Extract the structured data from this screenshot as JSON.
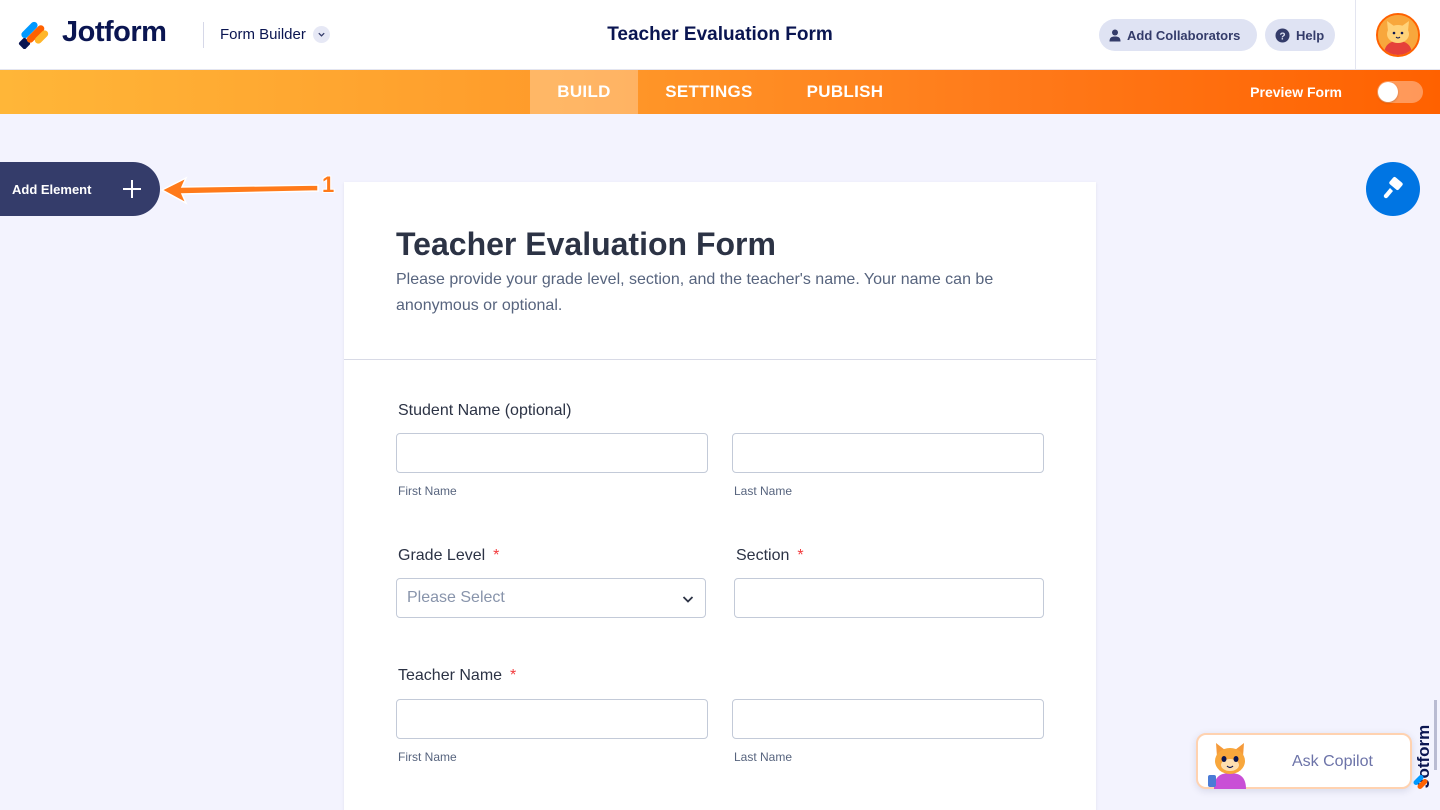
{
  "header": {
    "brand": "Jotform",
    "form_builder_label": "Form Builder",
    "form_title": "Teacher Evaluation Form",
    "add_collaborators_label": "Add Collaborators",
    "help_label": "Help"
  },
  "nav": {
    "tabs": [
      {
        "label": "BUILD",
        "active": true
      },
      {
        "label": "SETTINGS",
        "active": false
      },
      {
        "label": "PUBLISH",
        "active": false
      }
    ],
    "preview_label": "Preview Form",
    "preview_enabled": false
  },
  "sidebar": {
    "add_element_label": "Add Element",
    "step_marker": "1"
  },
  "form": {
    "title": "Teacher Evaluation Form",
    "description": "Please provide your grade level, section, and the teacher's name. Your name can be anonymous or optional.",
    "fields": {
      "student_name": {
        "label": "Student Name (optional)",
        "first_sublabel": "First Name",
        "last_sublabel": "Last Name",
        "first_value": "",
        "last_value": ""
      },
      "grade_level": {
        "label": "Grade Level",
        "required_mark": "*",
        "placeholder": "Please Select"
      },
      "section": {
        "label": "Section",
        "required_mark": "*",
        "value": ""
      },
      "teacher_name": {
        "label": "Teacher Name",
        "required_mark": "*",
        "first_sublabel": "First Name",
        "last_sublabel": "Last Name",
        "first_value": "",
        "last_value": ""
      }
    }
  },
  "copilot": {
    "label": "Ask Copilot"
  },
  "icons": {
    "collaborators": "user-icon",
    "help": "question-circle-icon",
    "add": "plus-icon",
    "designer": "paint-roller-icon",
    "dropdown": "chevron-down-icon"
  },
  "colors": {
    "brand_orange": "#ff6100",
    "navy": "#0a1551",
    "accent_blue": "#0075e3",
    "required_red": "#f23a3c",
    "sidebar_button": "#343c6a"
  }
}
